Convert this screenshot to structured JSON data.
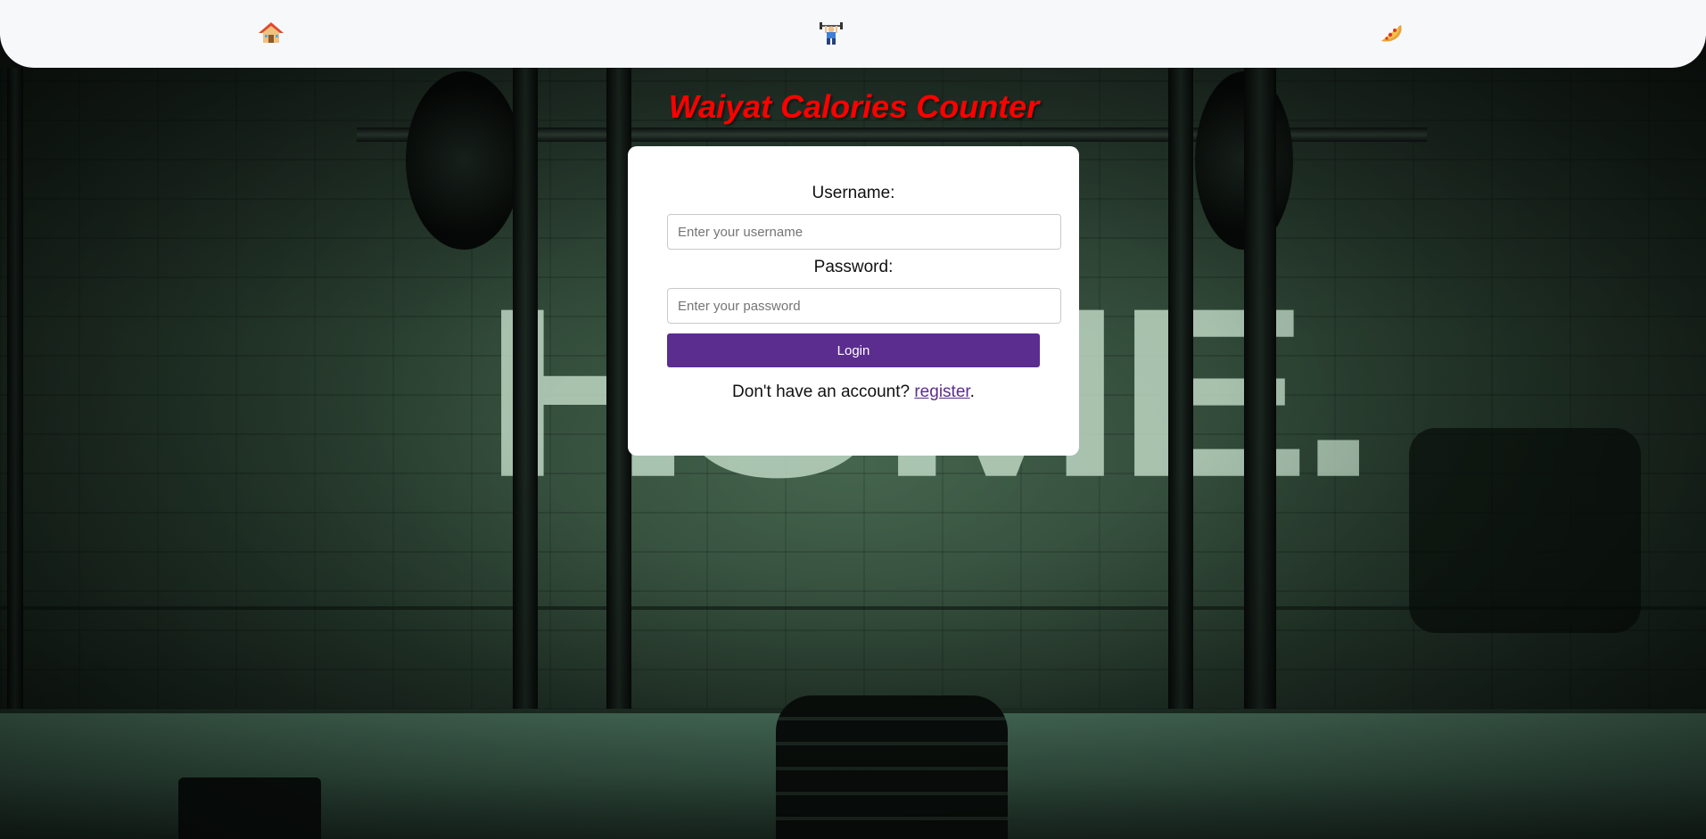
{
  "nav": {
    "items": [
      {
        "icon": "house-icon",
        "glyph": "🏠"
      },
      {
        "icon": "weightlifter-icon",
        "glyph": "🏋"
      },
      {
        "icon": "pizza-icon",
        "glyph": "🍕"
      }
    ]
  },
  "background": {
    "wall_text": "HOME."
  },
  "title": "Waiyat Calories Counter",
  "login_form": {
    "username_label": "Username:",
    "username_placeholder": "Enter your username",
    "username_value": "",
    "password_label": "Password:",
    "password_placeholder": "Enter your password",
    "password_value": "",
    "login_button_label": "Login",
    "register_prompt": "Don't have an account? ",
    "register_link_label": "register",
    "register_suffix": "."
  },
  "colors": {
    "title": "#ff0000",
    "button": "#5b2d8e",
    "navbar": "#f7f8fa",
    "card": "#ffffff"
  }
}
